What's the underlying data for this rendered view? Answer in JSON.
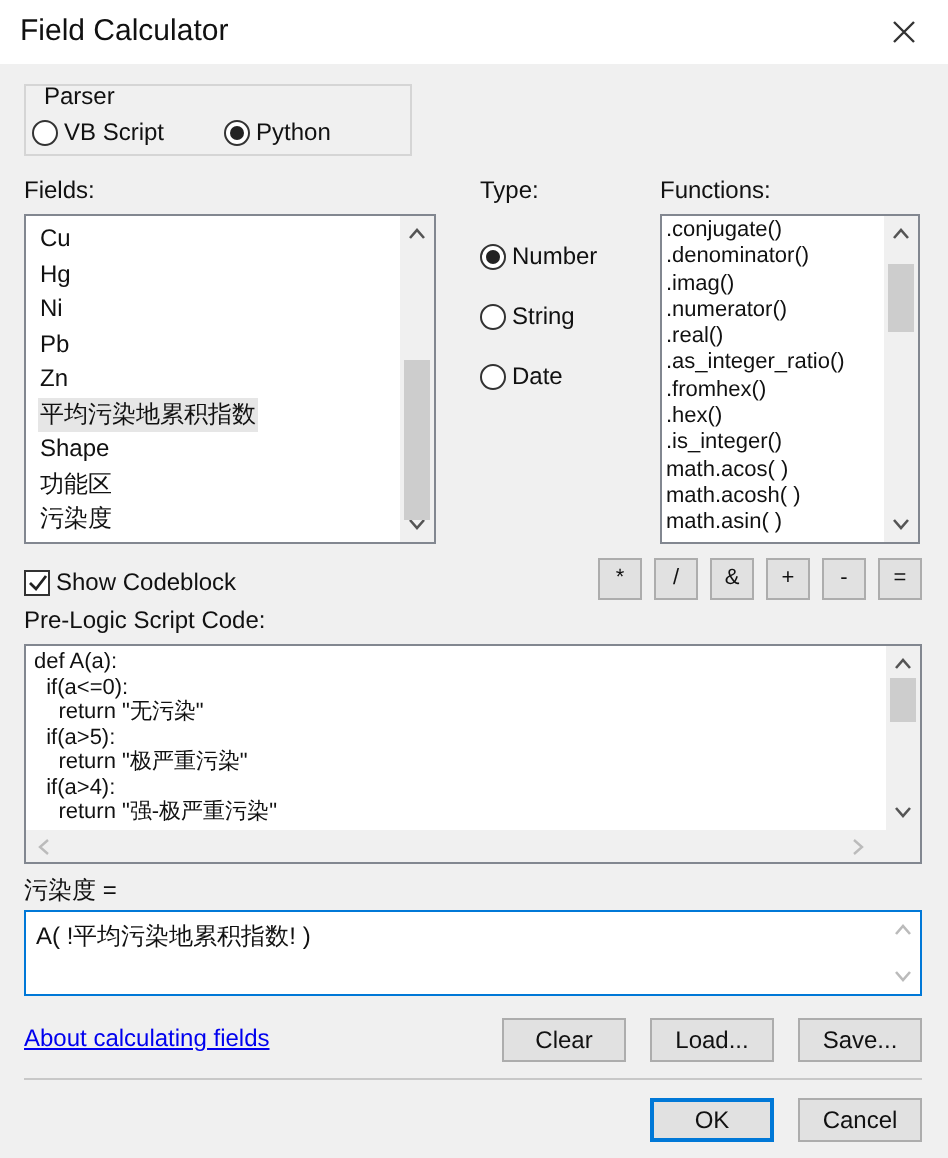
{
  "window": {
    "title": "Field Calculator"
  },
  "parser": {
    "label": "Parser",
    "options": [
      {
        "label": "VB Script",
        "selected": false
      },
      {
        "label": "Python",
        "selected": true
      }
    ]
  },
  "fields": {
    "label": "Fields:",
    "items": [
      {
        "label": "Cu",
        "selected": false
      },
      {
        "label": "Hg",
        "selected": false
      },
      {
        "label": "Ni",
        "selected": false
      },
      {
        "label": "Pb",
        "selected": false
      },
      {
        "label": "Zn",
        "selected": false
      },
      {
        "label": "平均污染地累积指数",
        "selected": true
      },
      {
        "label": "Shape",
        "selected": false
      },
      {
        "label": "功能区",
        "selected": false
      },
      {
        "label": "污染度",
        "selected": false
      }
    ]
  },
  "type": {
    "label": "Type:",
    "options": [
      {
        "label": "Number",
        "selected": true
      },
      {
        "label": "String",
        "selected": false
      },
      {
        "label": "Date",
        "selected": false
      }
    ]
  },
  "functions": {
    "label": "Functions:",
    "items": [
      ".conjugate()",
      ".denominator()",
      ".imag()",
      ".numerator()",
      ".real()",
      ".as_integer_ratio()",
      ".fromhex()",
      ".hex()",
      ".is_integer()",
      "math.acos( )",
      "math.acosh( )",
      "math.asin( )"
    ]
  },
  "show_codeblock": {
    "label": "Show Codeblock",
    "checked": true
  },
  "operators": [
    "*",
    "/",
    "&",
    "+",
    "-",
    "="
  ],
  "pre_logic": {
    "label": "Pre-Logic Script Code:",
    "lines": [
      "def A(a):",
      "  if(a<=0):",
      "    return \"无污染\"",
      "  if(a>5):",
      "    return \"极严重污染\"",
      "  if(a>4):",
      "    return \"强-极严重污染\""
    ]
  },
  "expression": {
    "label": "污染度 =",
    "value": "A( !平均污染地累积指数! )"
  },
  "help_link": "About calculating fields",
  "file_buttons": [
    "Clear",
    "Load...",
    "Save..."
  ],
  "dialog_buttons": [
    {
      "label": "OK",
      "default": true
    },
    {
      "label": "Cancel",
      "default": false
    }
  ]
}
